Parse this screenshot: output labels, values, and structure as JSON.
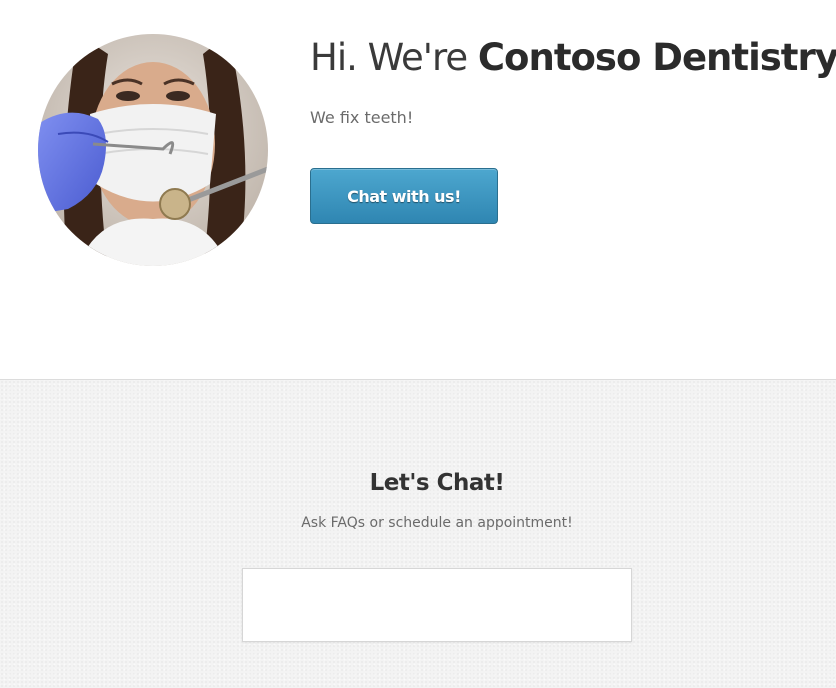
{
  "hero": {
    "greeting": "Hi. We're ",
    "brand_name": "Contoso Dentistry",
    "period": ".",
    "tagline": "We fix teeth!",
    "cta_label": "Chat with us!",
    "cta_color": "#3a95c1",
    "avatar_icon": "dentist-photo"
  },
  "chat": {
    "title": "Let's Chat!",
    "subtitle": "Ask FAQs or schedule an appointment!"
  }
}
